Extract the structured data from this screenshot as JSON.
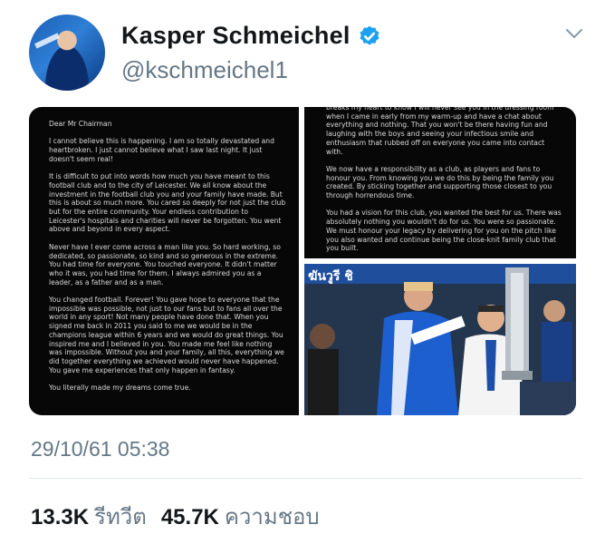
{
  "user": {
    "display_name": "Kasper Schmeichel",
    "handle": "@kschmeichel1"
  },
  "letter": {
    "left_paragraphs": [
      "Dear Mr Chairman",
      "I cannot believe this is happening. I am so totally devastated and heartbroken. I just cannot believe what I saw last night. It just doesn't seem real!",
      "It is difficult to put into words how much you have meant to this football club and to the city of Leicester. We all know about the investment in the football club you and your family have made. But this is about so much more. You cared so deeply for not just the club but for the entire community. Your endless contribution to Leicester's hospitals and charities will never be forgotten. You went above and beyond in every aspect.",
      "Never have I ever come across a man like you. So hard working, so dedicated, so passionate, so kind and so generous in the extreme. You had time for everyone. You touched everyone. It didn't matter who it was, you had time for them. I always admired you as a leader, as a father and as a man.",
      "You changed football. Forever! You gave hope to everyone that the impossible was possible, not just to our fans but to fans all over the world in any sport! Not many people have done that. When you signed me back in 2011 you said to me we would be in the champions league within 6 years and we would do great things. You inspired me and I believed in you. You made me feel like nothing was impossible. Without you and your family, all this, everything we did together everything we achieved would never have happened. You gave me experiences that only happen in fantasy.",
      "You literally made my dreams come true."
    ],
    "right_paragraphs": [
      "breaks my heart to know I will never see you in the dressing room when I came in early from my warm-up and have a chat about everything and nothing. That you won't be there having fun and laughing with the boys and seeing your infectious smile and enthusiasm that rubbed off on everyone you came into contact with.",
      "We now have a responsibility as a club, as players and fans to honour you. From knowing you we do this by being the family you created. By sticking together and supporting those closest to you through horrendous time.",
      "You had a vision for this club, you wanted the best for us. There was absolutely nothing you wouldn't do for us. You were so passionate. We must honour your legacy by delivering for you on the pitch like you also wanted and continue being the close-knit family club that you built."
    ],
    "photo_banner_text": "ฆันวูรี ชิ"
  },
  "timestamp": "29/10/61 05:38",
  "stats": {
    "retweets_count": "13.3K",
    "retweets_label": "รีทวีต",
    "likes_count": "45.7K",
    "likes_label": "ความชอบ"
  },
  "icons": {
    "verified": "verified-badge-icon",
    "menu": "chevron-down-icon"
  },
  "colors": {
    "verified": "#1da1f2",
    "secondary_text": "#657786",
    "divider": "#e1e8ed"
  }
}
